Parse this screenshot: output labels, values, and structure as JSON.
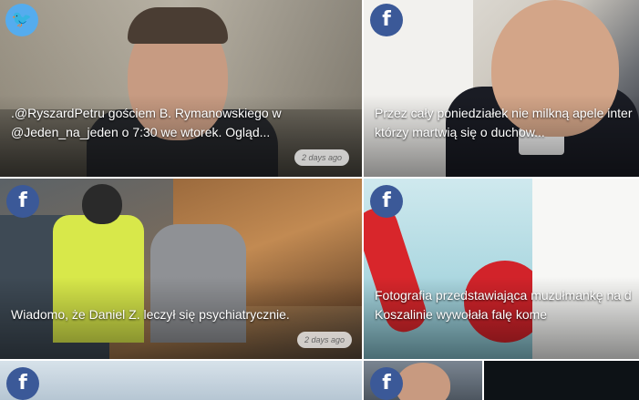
{
  "tiles": [
    {
      "network": "twitter",
      "icon": "twitter-icon",
      "caption_line1": ".@RyszardPetru gościem B. Rymanowskiego w",
      "caption_line2": "@Jeden_na_jeden o 7:30 we wtorek. Ogląd...",
      "time": "2 days ago"
    },
    {
      "network": "facebook",
      "icon": "facebook-icon",
      "caption_line1": "Przez cały poniedziałek nie milkną apele inter",
      "caption_line2": "którzy martwią się o duchow..."
    },
    {
      "network": "facebook",
      "icon": "facebook-icon",
      "caption_line1": "Wiadomo, że Daniel Z. leczył się psychiatrycznie.",
      "time": "2 days ago"
    },
    {
      "network": "facebook",
      "icon": "facebook-icon",
      "caption_line1": "Fotografia przedstawiająca muzułmankę na d",
      "caption_line2": "Koszalinie wywołała falę kome"
    },
    {
      "network": "facebook",
      "icon": "facebook-icon"
    },
    {
      "network": "facebook",
      "icon": "facebook-icon"
    }
  ],
  "icons": {
    "facebook_glyph": "f",
    "twitter_glyph": "🐦"
  },
  "colors": {
    "facebook": "#3b5998",
    "twitter": "#55acee"
  }
}
